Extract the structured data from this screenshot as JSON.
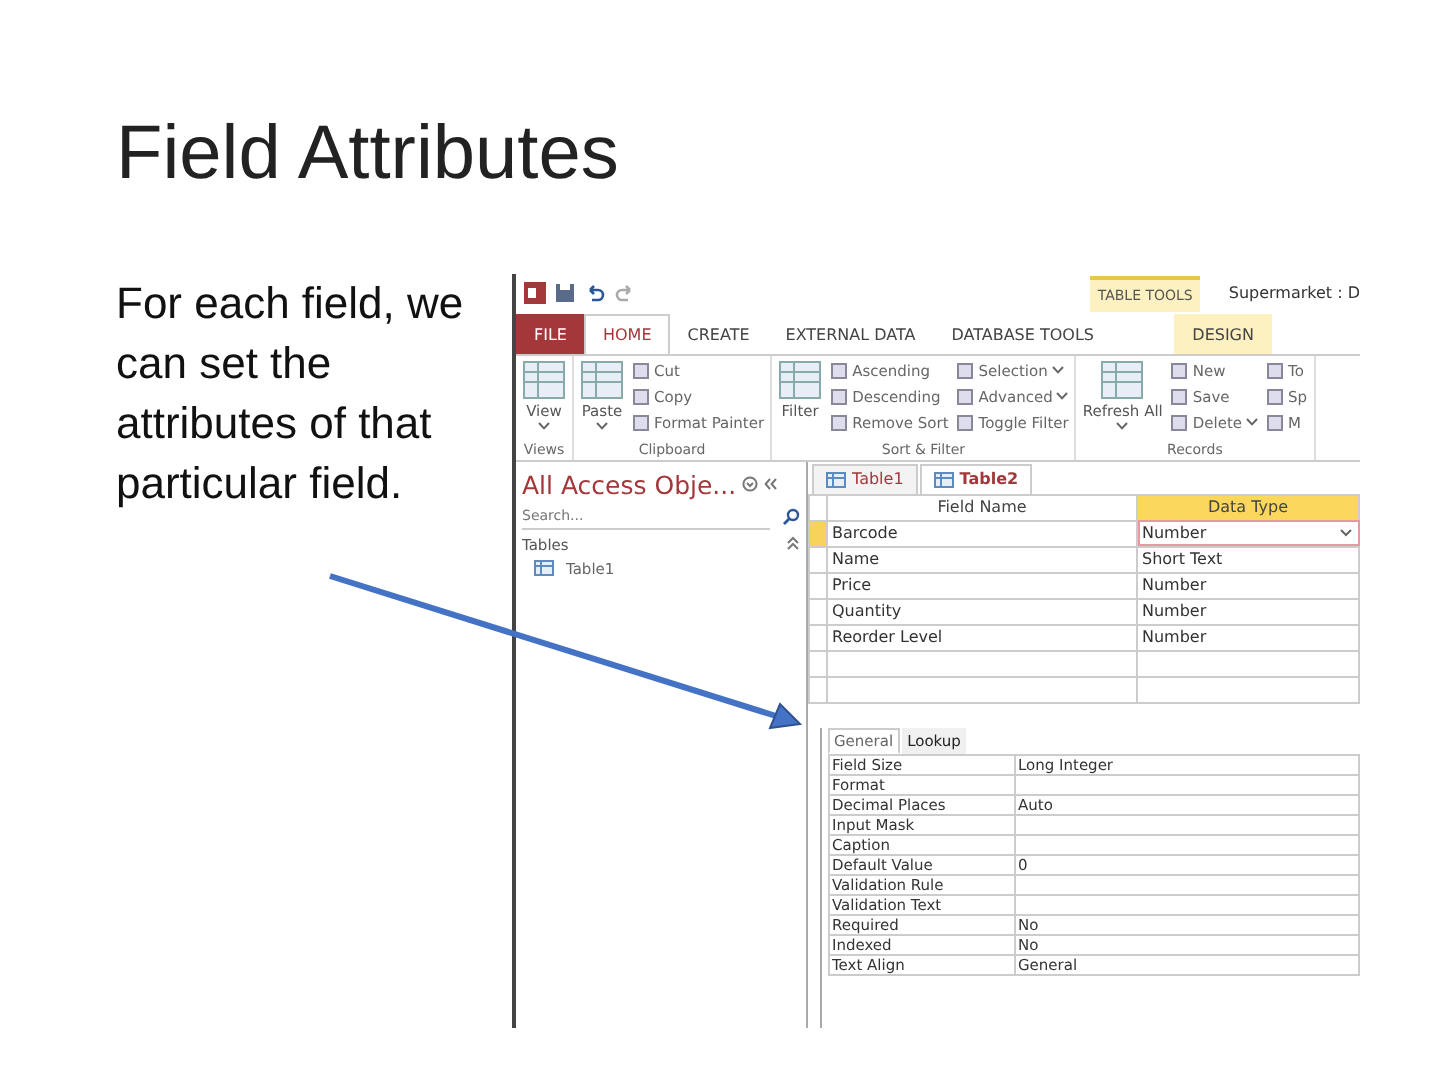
{
  "slide": {
    "title": "Field Attributes",
    "body": "For each field, we can set the attributes of that particular field."
  },
  "app": {
    "contextual_group": "TABLE TOOLS",
    "window_title": "Supermarket : D",
    "tabs": [
      {
        "label": "FILE",
        "kind": "file",
        "selected": false
      },
      {
        "label": "HOME",
        "kind": "normal",
        "selected": true
      },
      {
        "label": "CREATE",
        "kind": "normal",
        "selected": false
      },
      {
        "label": "EXTERNAL DATA",
        "kind": "normal",
        "selected": false
      },
      {
        "label": "DATABASE TOOLS",
        "kind": "normal",
        "selected": false
      },
      {
        "label": "DESIGN",
        "kind": "contextual",
        "selected": false
      }
    ],
    "ribbon_groups": [
      {
        "name": "Views",
        "commands": [
          {
            "label": "View",
            "kind": "large",
            "dropdown": true
          }
        ]
      },
      {
        "name": "Clipboard",
        "commands": [
          {
            "label": "Paste",
            "kind": "large",
            "dropdown": true
          },
          {
            "label": "Cut",
            "kind": "small",
            "dropdown": false
          },
          {
            "label": "Copy",
            "kind": "small",
            "dropdown": false
          },
          {
            "label": "Format Painter",
            "kind": "small",
            "dropdown": false
          }
        ]
      },
      {
        "name": "Sort & Filter",
        "commands": [
          {
            "label": "Filter",
            "kind": "large",
            "dropdown": false
          },
          {
            "label": "Ascending",
            "kind": "small",
            "dropdown": false
          },
          {
            "label": "Descending",
            "kind": "small",
            "dropdown": false
          },
          {
            "label": "Remove Sort",
            "kind": "small",
            "dropdown": false
          },
          {
            "label": "Selection",
            "kind": "small",
            "dropdown": true
          },
          {
            "label": "Advanced",
            "kind": "small",
            "dropdown": true
          },
          {
            "label": "Toggle Filter",
            "kind": "small",
            "dropdown": false
          }
        ]
      },
      {
        "name": "Records",
        "commands": [
          {
            "label": "Refresh All",
            "kind": "large",
            "dropdown": true
          },
          {
            "label": "New",
            "kind": "small",
            "dropdown": false
          },
          {
            "label": "Save",
            "kind": "small",
            "dropdown": false
          },
          {
            "label": "Delete",
            "kind": "small",
            "dropdown": true
          },
          {
            "label": "To",
            "kind": "small",
            "dropdown": false
          },
          {
            "label": "Sp",
            "kind": "small",
            "dropdown": false
          },
          {
            "label": "M",
            "kind": "small",
            "dropdown": false
          }
        ]
      }
    ],
    "nav_pane": {
      "title": "All Access Obje...",
      "search_placeholder": "Search...",
      "section": "Tables",
      "items": [
        "Table1"
      ]
    },
    "document_tabs": [
      {
        "label": "Table1",
        "selected": false
      },
      {
        "label": "Table2",
        "selected": true
      }
    ],
    "design_grid": {
      "columns": [
        "Field Name",
        "Data Type"
      ],
      "rows": [
        {
          "field_name": "Barcode",
          "data_type": "Number",
          "selected": true
        },
        {
          "field_name": "Name",
          "data_type": "Short Text",
          "selected": false
        },
        {
          "field_name": "Price",
          "data_type": "Number",
          "selected": false
        },
        {
          "field_name": "Quantity",
          "data_type": "Number",
          "selected": false
        },
        {
          "field_name": "Reorder Level",
          "data_type": "Number",
          "selected": false
        }
      ]
    },
    "property_tabs": [
      {
        "label": "General",
        "selected": true
      },
      {
        "label": "Lookup",
        "selected": false
      }
    ],
    "properties": [
      {
        "name": "Field Size",
        "value": "Long Integer"
      },
      {
        "name": "Format"
      },
      {
        "name": "Decimal Places",
        "value": "Auto"
      },
      {
        "name": "Input Mask"
      },
      {
        "name": "Caption"
      },
      {
        "name": "Default Value",
        "value": "0"
      },
      {
        "name": "Validation Rule"
      },
      {
        "name": "Validation Text"
      },
      {
        "name": "Required",
        "value": "No"
      },
      {
        "name": "Indexed",
        "value": "No"
      },
      {
        "name": "Text Align",
        "value": "General"
      }
    ]
  }
}
